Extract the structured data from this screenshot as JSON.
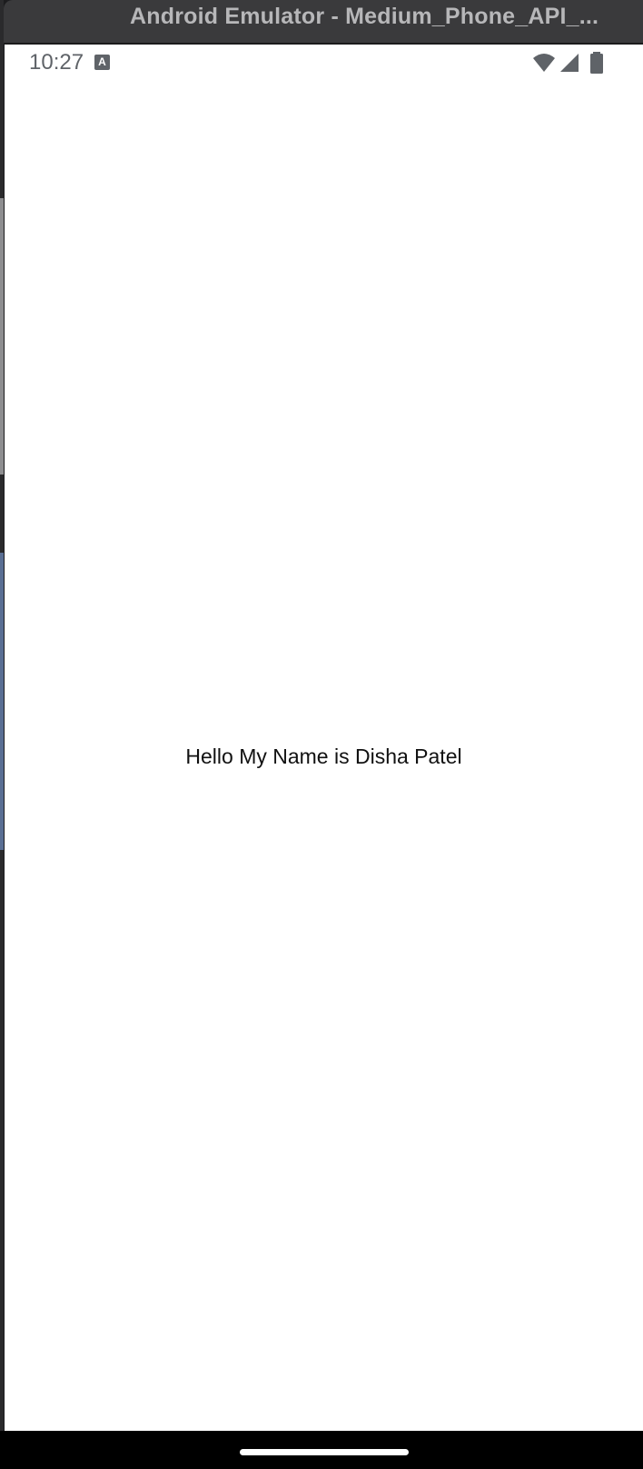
{
  "window": {
    "title": "Android Emulator - Medium_Phone_API_..."
  },
  "status_bar": {
    "time": "10:27",
    "notification_icon": "a-notification-icon",
    "notification_glyph": "A",
    "icons": [
      "wifi-icon",
      "cellular-signal-icon",
      "battery-icon"
    ]
  },
  "app": {
    "text": "Hello My Name is Disha Patel"
  },
  "nav_bar": {
    "handle": "home-gesture-handle"
  }
}
